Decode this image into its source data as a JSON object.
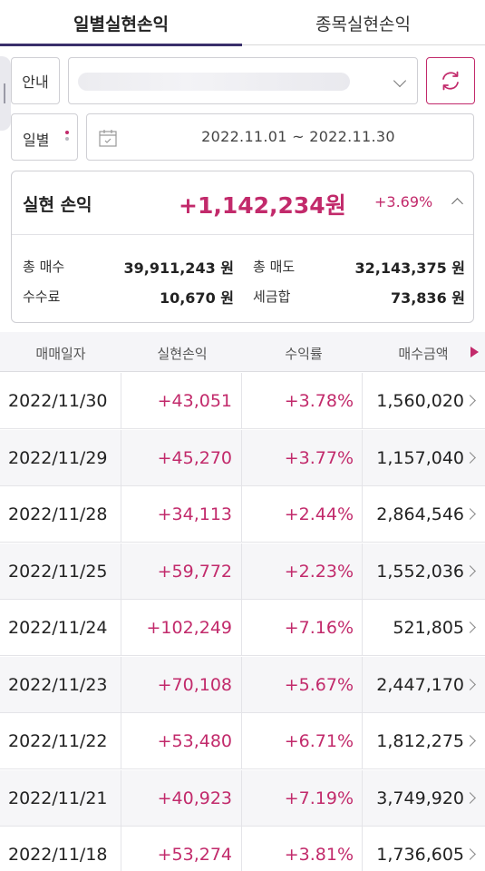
{
  "tabs": [
    {
      "label": "일별실현손익",
      "active": true
    },
    {
      "label": "종목실현손익",
      "active": false
    }
  ],
  "account": {
    "label": "안내",
    "selected_value": ""
  },
  "period": {
    "label": "일별",
    "date_range": "2022.11.01 ~ 2022.11.30"
  },
  "summary": {
    "title": "실현 손익",
    "amount": "+1,142,234원",
    "rate": "+3.69%",
    "total_buy_label": "총 매수",
    "total_buy_value": "39,911,243 원",
    "total_sell_label": "총 매도",
    "total_sell_value": "32,143,375 원",
    "fee_label": "수수료",
    "fee_value": "10,670 원",
    "tax_label": "세금합",
    "tax_value": "73,836 원"
  },
  "table": {
    "columns": [
      "매매일자",
      "실현손익",
      "수익률",
      "매수금액"
    ],
    "rows": [
      {
        "date": "2022/11/30",
        "pl": "+43,051",
        "rate": "+3.78%",
        "buy": "1,560,020"
      },
      {
        "date": "2022/11/29",
        "pl": "+45,270",
        "rate": "+3.77%",
        "buy": "1,157,040"
      },
      {
        "date": "2022/11/28",
        "pl": "+34,113",
        "rate": "+2.44%",
        "buy": "2,864,546"
      },
      {
        "date": "2022/11/25",
        "pl": "+59,772",
        "rate": "+2.23%",
        "buy": "1,552,036"
      },
      {
        "date": "2022/11/24",
        "pl": "+102,249",
        "rate": "+7.16%",
        "buy": "521,805"
      },
      {
        "date": "2022/11/23",
        "pl": "+70,108",
        "rate": "+5.67%",
        "buy": "2,447,170"
      },
      {
        "date": "2022/11/22",
        "pl": "+53,480",
        "rate": "+6.71%",
        "buy": "1,812,275"
      },
      {
        "date": "2022/11/21",
        "pl": "+40,923",
        "rate": "+7.19%",
        "buy": "3,749,920"
      },
      {
        "date": "2022/11/18",
        "pl": "+53,274",
        "rate": "+3.81%",
        "buy": "1,736,605"
      }
    ]
  },
  "colors": {
    "accent": "#c22a6b",
    "tab_indicator": "#3a2f6b"
  },
  "icons": {
    "refresh": "refresh-icon",
    "calendar": "calendar-icon",
    "dropdown": "chevron-down-icon",
    "collapse": "chevron-up-icon",
    "scroll_right": "arrow-right-icon",
    "row_detail": "chevron-right-icon"
  }
}
